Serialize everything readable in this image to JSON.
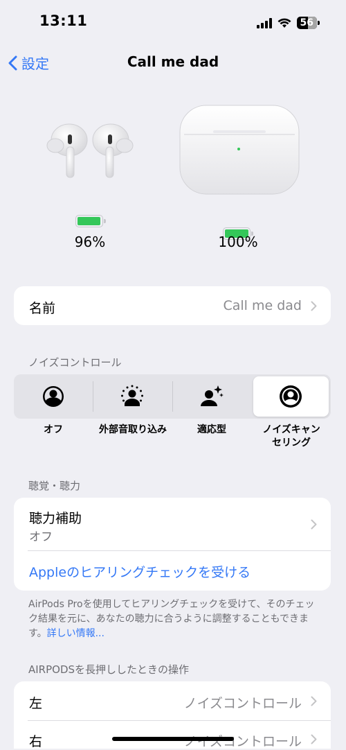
{
  "status_bar": {
    "time": "13:11",
    "battery": "56",
    "battery_level": 0.56
  },
  "nav": {
    "back_label": "設定",
    "title": "Call me dad"
  },
  "devices": {
    "earbuds": {
      "percent": "96%",
      "level": 0.96
    },
    "case": {
      "percent": "100%",
      "level": 1.0
    }
  },
  "name_row": {
    "label": "名前",
    "value": "Call me dad"
  },
  "noise_control": {
    "header": "ノイズコントロール",
    "options": [
      {
        "label": "オフ",
        "icon": "person-off-icon"
      },
      {
        "label": "外部音取り込み",
        "icon": "transparency-icon"
      },
      {
        "label": "適応型",
        "icon": "adaptive-icon"
      },
      {
        "label_line1": "ノイズキャン",
        "label_line2": "セリング",
        "icon": "noise-cancelling-icon"
      }
    ],
    "selected": "ノイズキャンセリング"
  },
  "hearing": {
    "header": "聴覚・聴力",
    "assist_label": "聴力補助",
    "assist_value": "オフ",
    "check_link": "Appleのヒアリングチェックを受ける",
    "footer_text": "AirPods Proを使用してヒアリングチェックを受けて、そのチェック結果を元に、あなたの聴力に合うように調整することもできます。",
    "footer_link": "詳しい情報..."
  },
  "press_hold": {
    "header": "AIRPODSを長押ししたときの操作",
    "rows": [
      {
        "label": "左",
        "value": "ノイズコントロール"
      },
      {
        "label": "右",
        "value": "ノイズコントロール"
      }
    ]
  }
}
